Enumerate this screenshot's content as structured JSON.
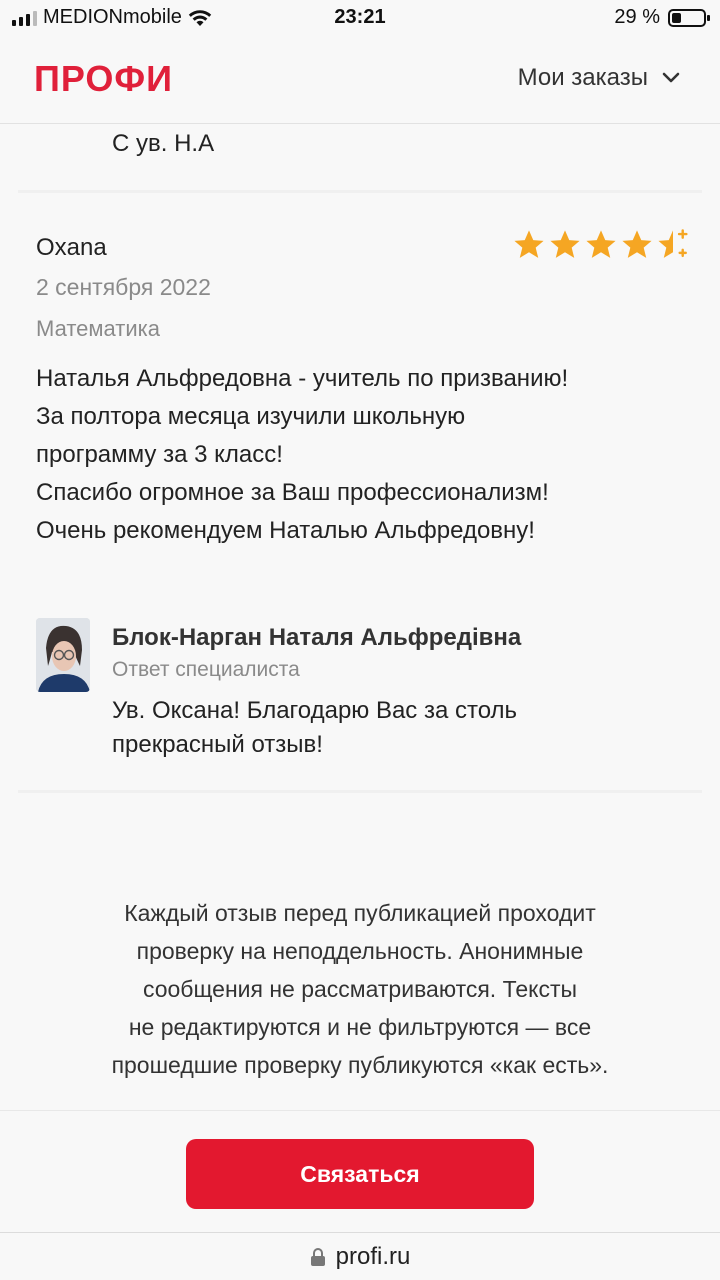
{
  "status_bar": {
    "carrier": "MEDIONmobile",
    "time": "23:21",
    "battery": "29 %",
    "battery_level": 0.29
  },
  "header": {
    "logo": "ПРОФИ",
    "orders_label": "Мои заказы"
  },
  "previous_review": {
    "signature": "С ув. Н.А"
  },
  "review": {
    "author": "Oxana",
    "rating": 4.5,
    "date": "2 сентября 2022",
    "subject": "Математика",
    "text_lines": [
      "Наталья Альфредовна - учитель по призванию!",
      "За полтора месяца изучили школьную",
      "программу за 3 класс!",
      "Спасибо огромное за Ваш профессионализм!",
      "Очень рекомендуем Наталью Альфредовну!"
    ]
  },
  "reply": {
    "name": "Блок-Нарган Наталя Альфредівна",
    "role": "Ответ специалиста",
    "text_lines": [
      "Ув. Оксана! Благодарю Вас за столь",
      "прекрасный отзыв!"
    ]
  },
  "notice": {
    "lines": [
      "Каждый отзыв перед публикацией проходит",
      "проверку на неподдельность. Анонимные",
      "сообщения не рассматриваются. Тексты",
      "не редактируются и не фильтруются — все",
      "прошедшие проверку публикуются «как есть»."
    ]
  },
  "actions": {
    "contact_label": "Связаться"
  },
  "browser": {
    "url": "profi.ru"
  },
  "colors": {
    "brand": "#e0203a",
    "button": "#e3182f",
    "star": "#f5a623"
  }
}
